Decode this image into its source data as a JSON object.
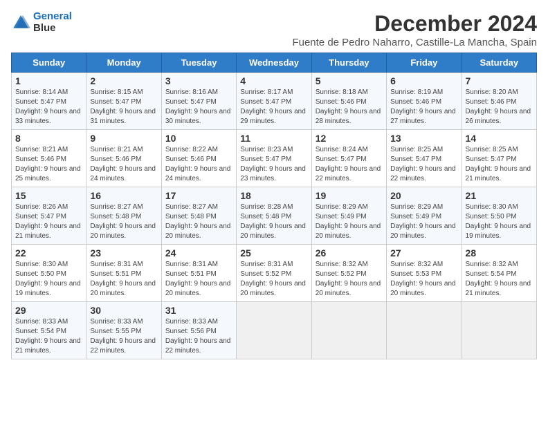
{
  "logo": {
    "line1": "General",
    "line2": "Blue"
  },
  "title": "December 2024",
  "subtitle": "Fuente de Pedro Naharro, Castille-La Mancha, Spain",
  "headers": [
    "Sunday",
    "Monday",
    "Tuesday",
    "Wednesday",
    "Thursday",
    "Friday",
    "Saturday"
  ],
  "weeks": [
    [
      {
        "day": "1",
        "info": "Sunrise: 8:14 AM\nSunset: 5:47 PM\nDaylight: 9 hours and 33 minutes."
      },
      {
        "day": "2",
        "info": "Sunrise: 8:15 AM\nSunset: 5:47 PM\nDaylight: 9 hours and 31 minutes."
      },
      {
        "day": "3",
        "info": "Sunrise: 8:16 AM\nSunset: 5:47 PM\nDaylight: 9 hours and 30 minutes."
      },
      {
        "day": "4",
        "info": "Sunrise: 8:17 AM\nSunset: 5:47 PM\nDaylight: 9 hours and 29 minutes."
      },
      {
        "day": "5",
        "info": "Sunrise: 8:18 AM\nSunset: 5:46 PM\nDaylight: 9 hours and 28 minutes."
      },
      {
        "day": "6",
        "info": "Sunrise: 8:19 AM\nSunset: 5:46 PM\nDaylight: 9 hours and 27 minutes."
      },
      {
        "day": "7",
        "info": "Sunrise: 8:20 AM\nSunset: 5:46 PM\nDaylight: 9 hours and 26 minutes."
      }
    ],
    [
      {
        "day": "8",
        "info": "Sunrise: 8:21 AM\nSunset: 5:46 PM\nDaylight: 9 hours and 25 minutes."
      },
      {
        "day": "9",
        "info": "Sunrise: 8:21 AM\nSunset: 5:46 PM\nDaylight: 9 hours and 24 minutes."
      },
      {
        "day": "10",
        "info": "Sunrise: 8:22 AM\nSunset: 5:46 PM\nDaylight: 9 hours and 24 minutes."
      },
      {
        "day": "11",
        "info": "Sunrise: 8:23 AM\nSunset: 5:47 PM\nDaylight: 9 hours and 23 minutes."
      },
      {
        "day": "12",
        "info": "Sunrise: 8:24 AM\nSunset: 5:47 PM\nDaylight: 9 hours and 22 minutes."
      },
      {
        "day": "13",
        "info": "Sunrise: 8:25 AM\nSunset: 5:47 PM\nDaylight: 9 hours and 22 minutes."
      },
      {
        "day": "14",
        "info": "Sunrise: 8:25 AM\nSunset: 5:47 PM\nDaylight: 9 hours and 21 minutes."
      }
    ],
    [
      {
        "day": "15",
        "info": "Sunrise: 8:26 AM\nSunset: 5:47 PM\nDaylight: 9 hours and 21 minutes."
      },
      {
        "day": "16",
        "info": "Sunrise: 8:27 AM\nSunset: 5:48 PM\nDaylight: 9 hours and 20 minutes."
      },
      {
        "day": "17",
        "info": "Sunrise: 8:27 AM\nSunset: 5:48 PM\nDaylight: 9 hours and 20 minutes."
      },
      {
        "day": "18",
        "info": "Sunrise: 8:28 AM\nSunset: 5:48 PM\nDaylight: 9 hours and 20 minutes."
      },
      {
        "day": "19",
        "info": "Sunrise: 8:29 AM\nSunset: 5:49 PM\nDaylight: 9 hours and 20 minutes."
      },
      {
        "day": "20",
        "info": "Sunrise: 8:29 AM\nSunset: 5:49 PM\nDaylight: 9 hours and 20 minutes."
      },
      {
        "day": "21",
        "info": "Sunrise: 8:30 AM\nSunset: 5:50 PM\nDaylight: 9 hours and 19 minutes."
      }
    ],
    [
      {
        "day": "22",
        "info": "Sunrise: 8:30 AM\nSunset: 5:50 PM\nDaylight: 9 hours and 19 minutes."
      },
      {
        "day": "23",
        "info": "Sunrise: 8:31 AM\nSunset: 5:51 PM\nDaylight: 9 hours and 20 minutes."
      },
      {
        "day": "24",
        "info": "Sunrise: 8:31 AM\nSunset: 5:51 PM\nDaylight: 9 hours and 20 minutes."
      },
      {
        "day": "25",
        "info": "Sunrise: 8:31 AM\nSunset: 5:52 PM\nDaylight: 9 hours and 20 minutes."
      },
      {
        "day": "26",
        "info": "Sunrise: 8:32 AM\nSunset: 5:52 PM\nDaylight: 9 hours and 20 minutes."
      },
      {
        "day": "27",
        "info": "Sunrise: 8:32 AM\nSunset: 5:53 PM\nDaylight: 9 hours and 20 minutes."
      },
      {
        "day": "28",
        "info": "Sunrise: 8:32 AM\nSunset: 5:54 PM\nDaylight: 9 hours and 21 minutes."
      }
    ],
    [
      {
        "day": "29",
        "info": "Sunrise: 8:33 AM\nSunset: 5:54 PM\nDaylight: 9 hours and 21 minutes."
      },
      {
        "day": "30",
        "info": "Sunrise: 8:33 AM\nSunset: 5:55 PM\nDaylight: 9 hours and 22 minutes."
      },
      {
        "day": "31",
        "info": "Sunrise: 8:33 AM\nSunset: 5:56 PM\nDaylight: 9 hours and 22 minutes."
      },
      null,
      null,
      null,
      null
    ]
  ]
}
